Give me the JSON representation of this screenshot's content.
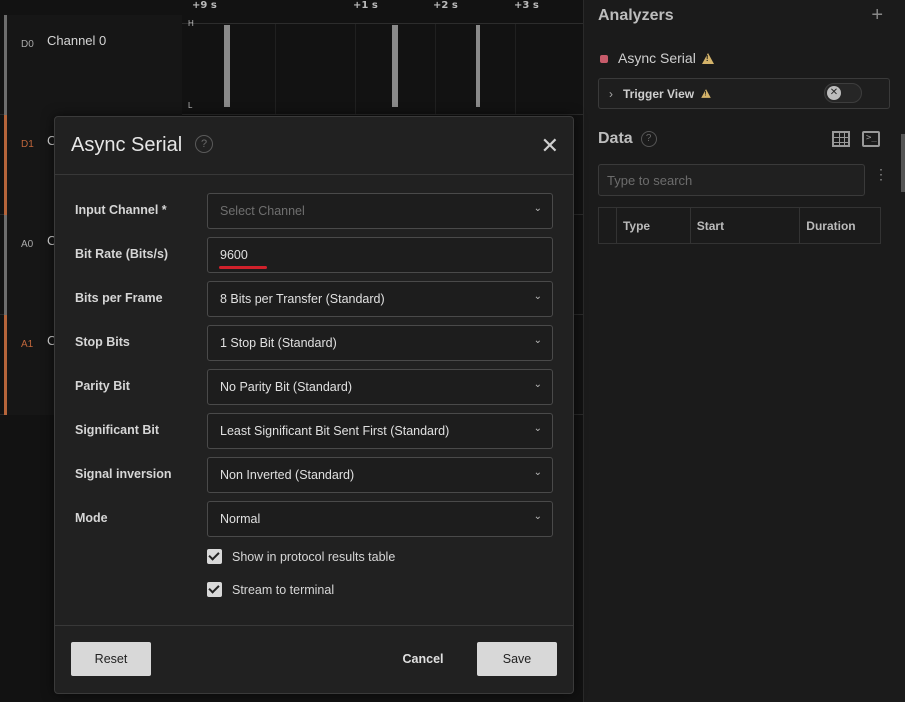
{
  "timeline": {
    "ticks": [
      "+9 s",
      "+1 s",
      "+2 s",
      "+3 s"
    ]
  },
  "channels": [
    {
      "id": "D0",
      "name": "Channel 0"
    },
    {
      "id": "D1",
      "name": "Cl"
    },
    {
      "id": "A0",
      "name": "Cl"
    },
    {
      "id": "A1",
      "name": "Cl"
    }
  ],
  "waveform": {
    "high": "H",
    "low": "L"
  },
  "analyzers": {
    "title": "Analyzers",
    "add_icon": "plus-icon",
    "item_label": "Async Serial",
    "trigger_label": "Trigger View",
    "item_color": "#c75b6a",
    "warning_color": "#d4b36a"
  },
  "data_panel": {
    "title": "Data",
    "help": "?",
    "search_placeholder": "Type to search",
    "columns": [
      "Type",
      "Start",
      "Duration"
    ]
  },
  "modal": {
    "title": "Async Serial",
    "help": "?",
    "close": "✕",
    "fields": [
      {
        "label": "Input Channel *",
        "value": "Select Channel",
        "placeholder": true
      },
      {
        "label": "Bit Rate (Bits/s)",
        "value": "9600"
      },
      {
        "label": "Bits per Frame",
        "value": "8 Bits per Transfer (Standard)"
      },
      {
        "label": "Stop Bits",
        "value": "1 Stop Bit (Standard)"
      },
      {
        "label": "Parity Bit",
        "value": "No Parity Bit (Standard)"
      },
      {
        "label": "Significant Bit",
        "value": "Least Significant Bit Sent First (Standard)"
      },
      {
        "label": "Signal inversion",
        "value": "Non Inverted (Standard)"
      },
      {
        "label": "Mode",
        "value": "Normal"
      }
    ],
    "checkboxes": [
      {
        "label": "Show in protocol results table",
        "checked": true
      },
      {
        "label": "Stream to terminal",
        "checked": true
      }
    ],
    "buttons": {
      "reset": "Reset",
      "cancel": "Cancel",
      "save": "Save"
    },
    "highlight_color": "#d0212b"
  }
}
